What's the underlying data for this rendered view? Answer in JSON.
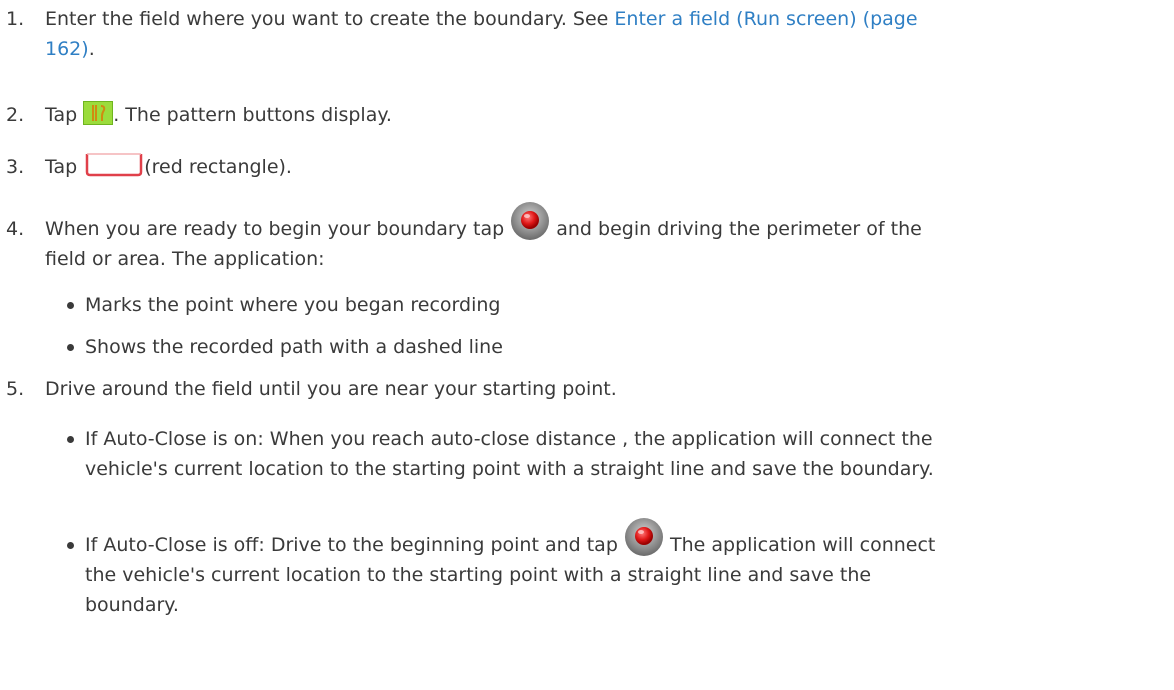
{
  "steps": [
    {
      "number": "1.",
      "text_before": "Enter the field where you want to create the boundary. See ",
      "link_line1": "Enter a field (Run screen) (page",
      "link_line2": "162)",
      "text_after": "."
    },
    {
      "number": "2.",
      "text_before": "Tap",
      "icon": "pattern-icon",
      "text_after": ". The pattern buttons display."
    },
    {
      "number": "3.",
      "text_before": "Tap",
      "icon": "red-rectangle-icon",
      "text_after": "(red rectangle)."
    },
    {
      "number": "4.",
      "text_before": "When you are ready to begin your boundary tap",
      "icon": "record-button-icon",
      "text_after_line1": "and begin driving the perimeter of the",
      "text_line2": "field or area. The application:",
      "bullets": [
        "Marks the point where you began recording",
        "Shows the recorded path with a dashed line"
      ]
    },
    {
      "number": "5.",
      "text": "Drive around the field until you are near your starting point.",
      "bullets": [
        {
          "line1": "If Auto-Close is on: When you reach auto-close distance , the application will connect the",
          "line2": "vehicle's current location to the starting point with a straight line and save the boundary."
        },
        {
          "line1_before": "If Auto-Close is off: Drive to the beginning point and tap",
          "icon": "record-button-icon",
          "line1_after": "The application will connect",
          "line2": "the vehicle's current location to the starting point with a straight line and save the",
          "line3": "boundary."
        }
      ]
    }
  ],
  "colors": {
    "text": "#3a3a3a",
    "link": "#2f7fc4",
    "pattern_icon_bg": "#9bdc3c",
    "record_red": "#e01818",
    "rectangle_red": "#e0404a"
  }
}
